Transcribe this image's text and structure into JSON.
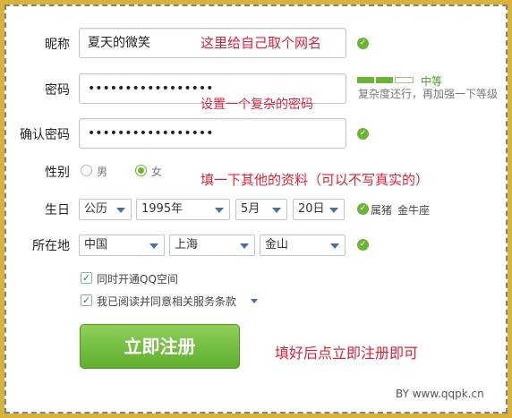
{
  "form": {
    "nickname": {
      "label": "昵称",
      "value": "夏天的微笑"
    },
    "password": {
      "label": "密码",
      "value": "•••••••••••••••••"
    },
    "confirm": {
      "label": "确认密码",
      "value": "•••••••••••••••••"
    },
    "gender": {
      "label": "性别",
      "male": "男",
      "female": "女",
      "selected": "女"
    },
    "birthday": {
      "label": "生日",
      "calendar": "公历",
      "year": "1995年",
      "month": "5月",
      "day": "20日",
      "zodiac": "属猪",
      "constellation": "金牛座"
    },
    "location": {
      "label": "所在地",
      "country": "中国",
      "province": "上海",
      "city": "金山"
    },
    "strength": {
      "label": "中等",
      "hint": "复杂度还行，再加强一下等级"
    },
    "options": {
      "qzone": "同时开通QQ空间",
      "agree": "我已阅读并同意相关服务条款"
    },
    "submit_label": "立即注册"
  },
  "notes": {
    "nickname": "这里给自己取个网名",
    "password": "设置一个复杂的密码",
    "profile": "填一下其他的资料（可以不写真实的）",
    "submit": "填好后点立即注册即可"
  },
  "watermark": "BY www.qqpk.cn",
  "colors": {
    "accent_green": "#6ab534",
    "note_red": "#e0203a",
    "frame_gold": "#d9b23a"
  }
}
